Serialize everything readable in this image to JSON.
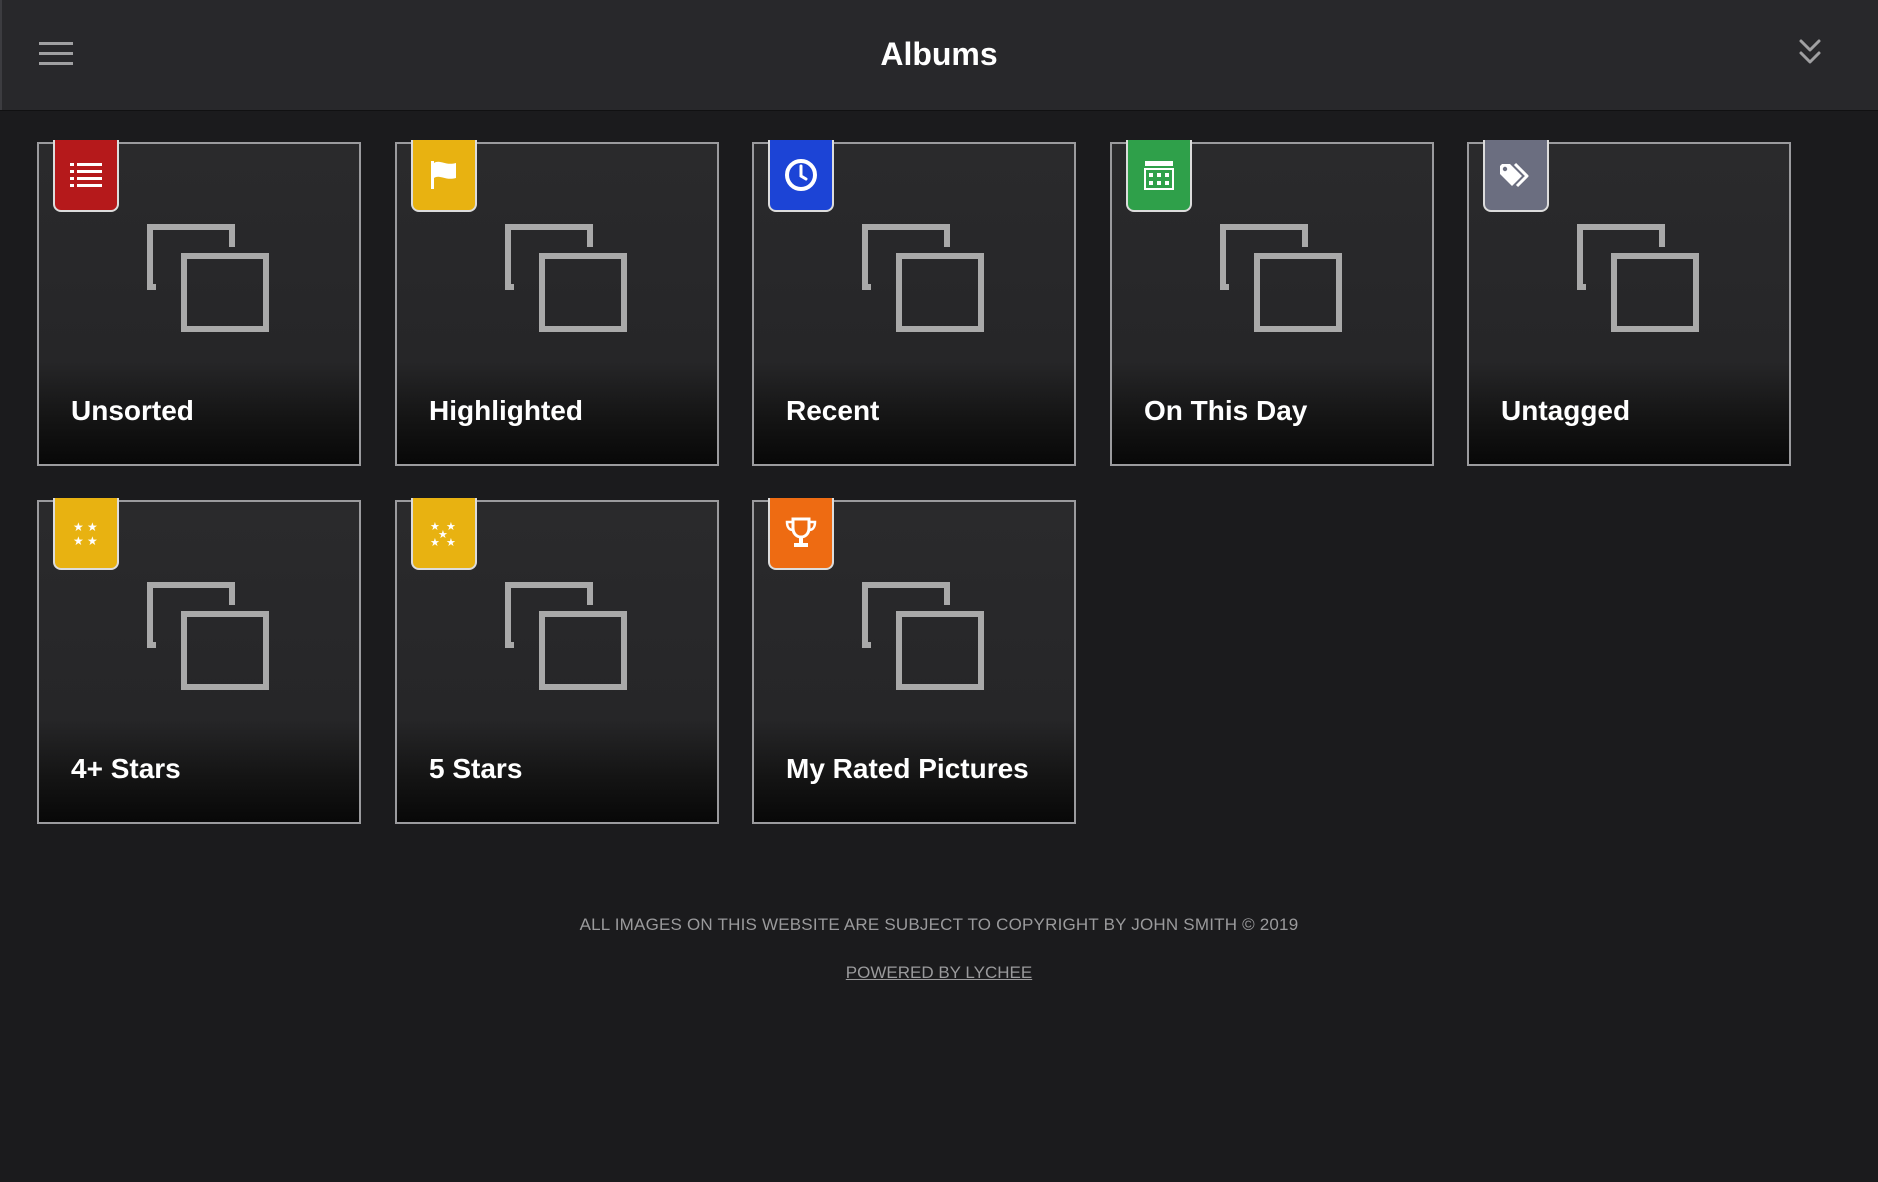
{
  "header": {
    "title": "Albums",
    "menu_icon": "hamburger-menu-icon",
    "collapse_icon": "double-chevron-down-icon"
  },
  "albums": [
    {
      "label": "Unsorted",
      "badge_icon": "list-icon",
      "badge_color": "#b5191b"
    },
    {
      "label": "Highlighted",
      "badge_icon": "flag-icon",
      "badge_color": "#e8b211"
    },
    {
      "label": "Recent",
      "badge_icon": "clock-icon",
      "badge_color": "#1c44d6"
    },
    {
      "label": "On This Day",
      "badge_icon": "calendar-icon",
      "badge_color": "#2fa04a"
    },
    {
      "label": "Untagged",
      "badge_icon": "tags-icon",
      "badge_color": "#6b6e80"
    },
    {
      "label": "4+ Stars",
      "badge_icon": "four-stars-icon",
      "badge_color": "#e8b211"
    },
    {
      "label": "5 Stars",
      "badge_icon": "five-stars-icon",
      "badge_color": "#e8b211"
    },
    {
      "label": "My Rated Pictures",
      "badge_icon": "trophy-icon",
      "badge_color": "#ee6b12"
    }
  ],
  "footer": {
    "copyright": "ALL IMAGES ON THIS WEBSITE ARE SUBJECT TO COPYRIGHT BY JOHN SMITH © 2019",
    "powered_by": "POWERED BY LYCHEE"
  },
  "colors": {
    "background": "#1b1b1d",
    "header": "#28282b",
    "tile_border": "#9b9b9e",
    "placeholder_icon": "#a9a9a9"
  }
}
